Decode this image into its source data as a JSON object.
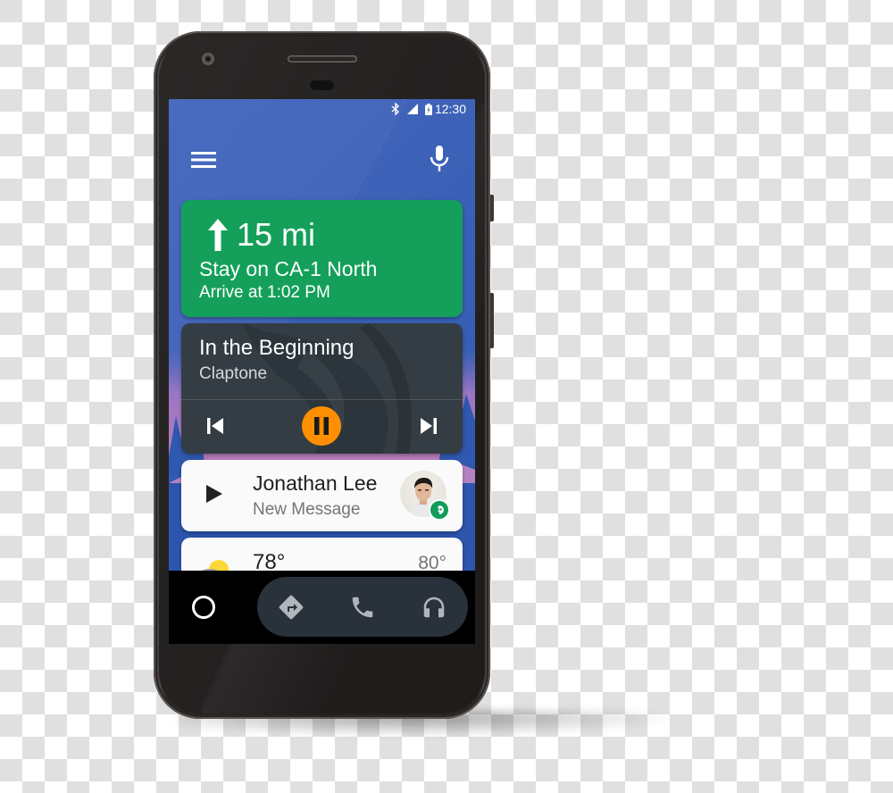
{
  "device": {
    "model": "Android phone",
    "frame_color": "#232120"
  },
  "status_bar": {
    "icons": [
      "bluetooth-icon",
      "signal-icon",
      "battery-icon"
    ],
    "time": "12:30"
  },
  "top_bar": {
    "menu_icon": "menu-icon",
    "voice_icon": "microphone-icon"
  },
  "navigation_card": {
    "direction_icon": "arrow-up-icon",
    "distance": "15 mi",
    "instruction": "Stay on CA-1 North",
    "eta": "Arrive at 1:02 PM",
    "color": "#14a05a"
  },
  "media_card": {
    "title": "In the Beginning",
    "artist": "Claptone",
    "controls": {
      "previous_icon": "skip-previous-icon",
      "play_pause_icon": "pause-icon",
      "next_icon": "skip-next-icon"
    },
    "accent_color": "#ff8f00"
  },
  "message_card": {
    "action_icon": "play-icon",
    "sender": "Jonathan Lee",
    "subtitle": "New Message",
    "app_badge": "hangouts-icon",
    "badge_color": "#0f9d58"
  },
  "weather_card": {
    "icon": "partly-cloudy-icon",
    "current_temp": "78°",
    "high_temp": "80°"
  },
  "bottom_nav": {
    "home_icon": "home-circle-icon",
    "facets": [
      {
        "name": "navigation",
        "icon": "directions-icon"
      },
      {
        "name": "phone",
        "icon": "phone-icon"
      },
      {
        "name": "media",
        "icon": "headphones-icon"
      }
    ]
  },
  "colors": {
    "wallpaper": "#3d62b8",
    "media_card_bg": "#343d44",
    "facet_bar_bg": "#29323a"
  }
}
